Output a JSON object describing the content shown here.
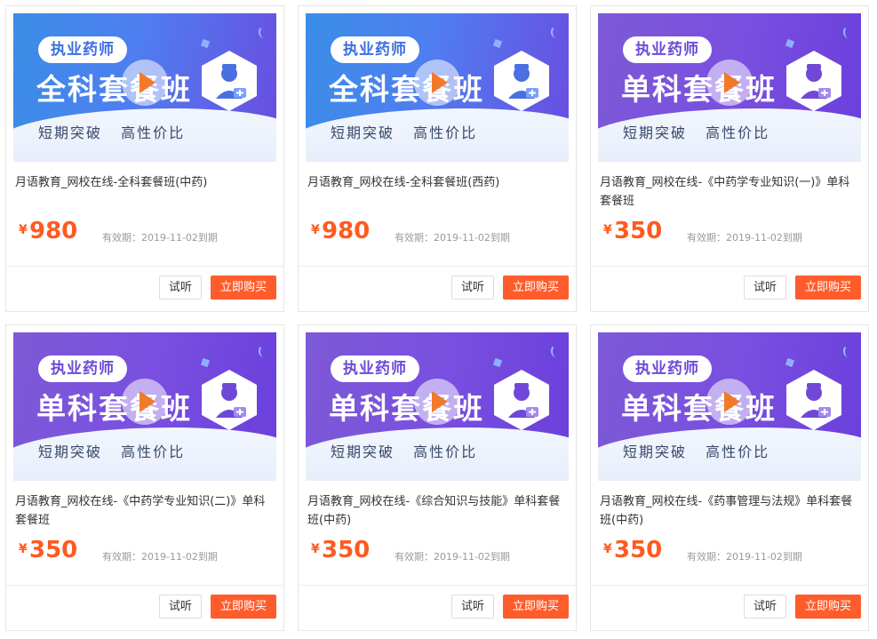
{
  "courses": [
    {
      "banner_tag": "执业药师",
      "banner_title": "全科套餐班",
      "banner_sub": "短期突破 高性价比",
      "banner_style": "full",
      "title": "月语教育_网校在线-全科套餐班(中药)",
      "currency": "¥",
      "price": "980",
      "expiry": "有效期：2019-11-02到期",
      "try_label": "试听",
      "buy_label": "立即购买"
    },
    {
      "banner_tag": "执业药师",
      "banner_title": "全科套餐班",
      "banner_sub": "短期突破 高性价比",
      "banner_style": "full",
      "title": "月语教育_网校在线-全科套餐班(西药)",
      "currency": "¥",
      "price": "980",
      "expiry": "有效期：2019-11-02到期",
      "try_label": "试听",
      "buy_label": "立即购买"
    },
    {
      "banner_tag": "执业药师",
      "banner_title": "单科套餐班",
      "banner_sub": "短期突破 高性价比",
      "banner_style": "single",
      "title": "月语教育_网校在线-《中药学专业知识(一)》单科套餐班",
      "currency": "¥",
      "price": "350",
      "expiry": "有效期：2019-11-02到期",
      "try_label": "试听",
      "buy_label": "立即购买"
    },
    {
      "banner_tag": "执业药师",
      "banner_title": "单科套餐班",
      "banner_sub": "短期突破 高性价比",
      "banner_style": "single",
      "title": "月语教育_网校在线-《中药学专业知识(二)》单科套餐班",
      "currency": "¥",
      "price": "350",
      "expiry": "有效期：2019-11-02到期",
      "try_label": "试听",
      "buy_label": "立即购买"
    },
    {
      "banner_tag": "执业药师",
      "banner_title": "单科套餐班",
      "banner_sub": "短期突破 高性价比",
      "banner_style": "single",
      "title": "月语教育_网校在线-《综合知识与技能》单科套餐班(中药)",
      "currency": "¥",
      "price": "350",
      "expiry": "有效期：2019-11-02到期",
      "try_label": "试听",
      "buy_label": "立即购买"
    },
    {
      "banner_tag": "执业药师",
      "banner_title": "单科套餐班",
      "banner_sub": "短期突破 高性价比",
      "banner_style": "single",
      "title": "月语教育_网校在线-《药事管理与法规》单科套餐班(中药)",
      "currency": "¥",
      "price": "350",
      "expiry": "有效期：2019-11-02到期",
      "try_label": "试听",
      "buy_label": "立即购买"
    }
  ],
  "colors": {
    "accent": "#ff5c2b",
    "price": "#ff5a1f",
    "banner_full": "#4f7ef0",
    "banner_single": "#7a4fe0"
  }
}
